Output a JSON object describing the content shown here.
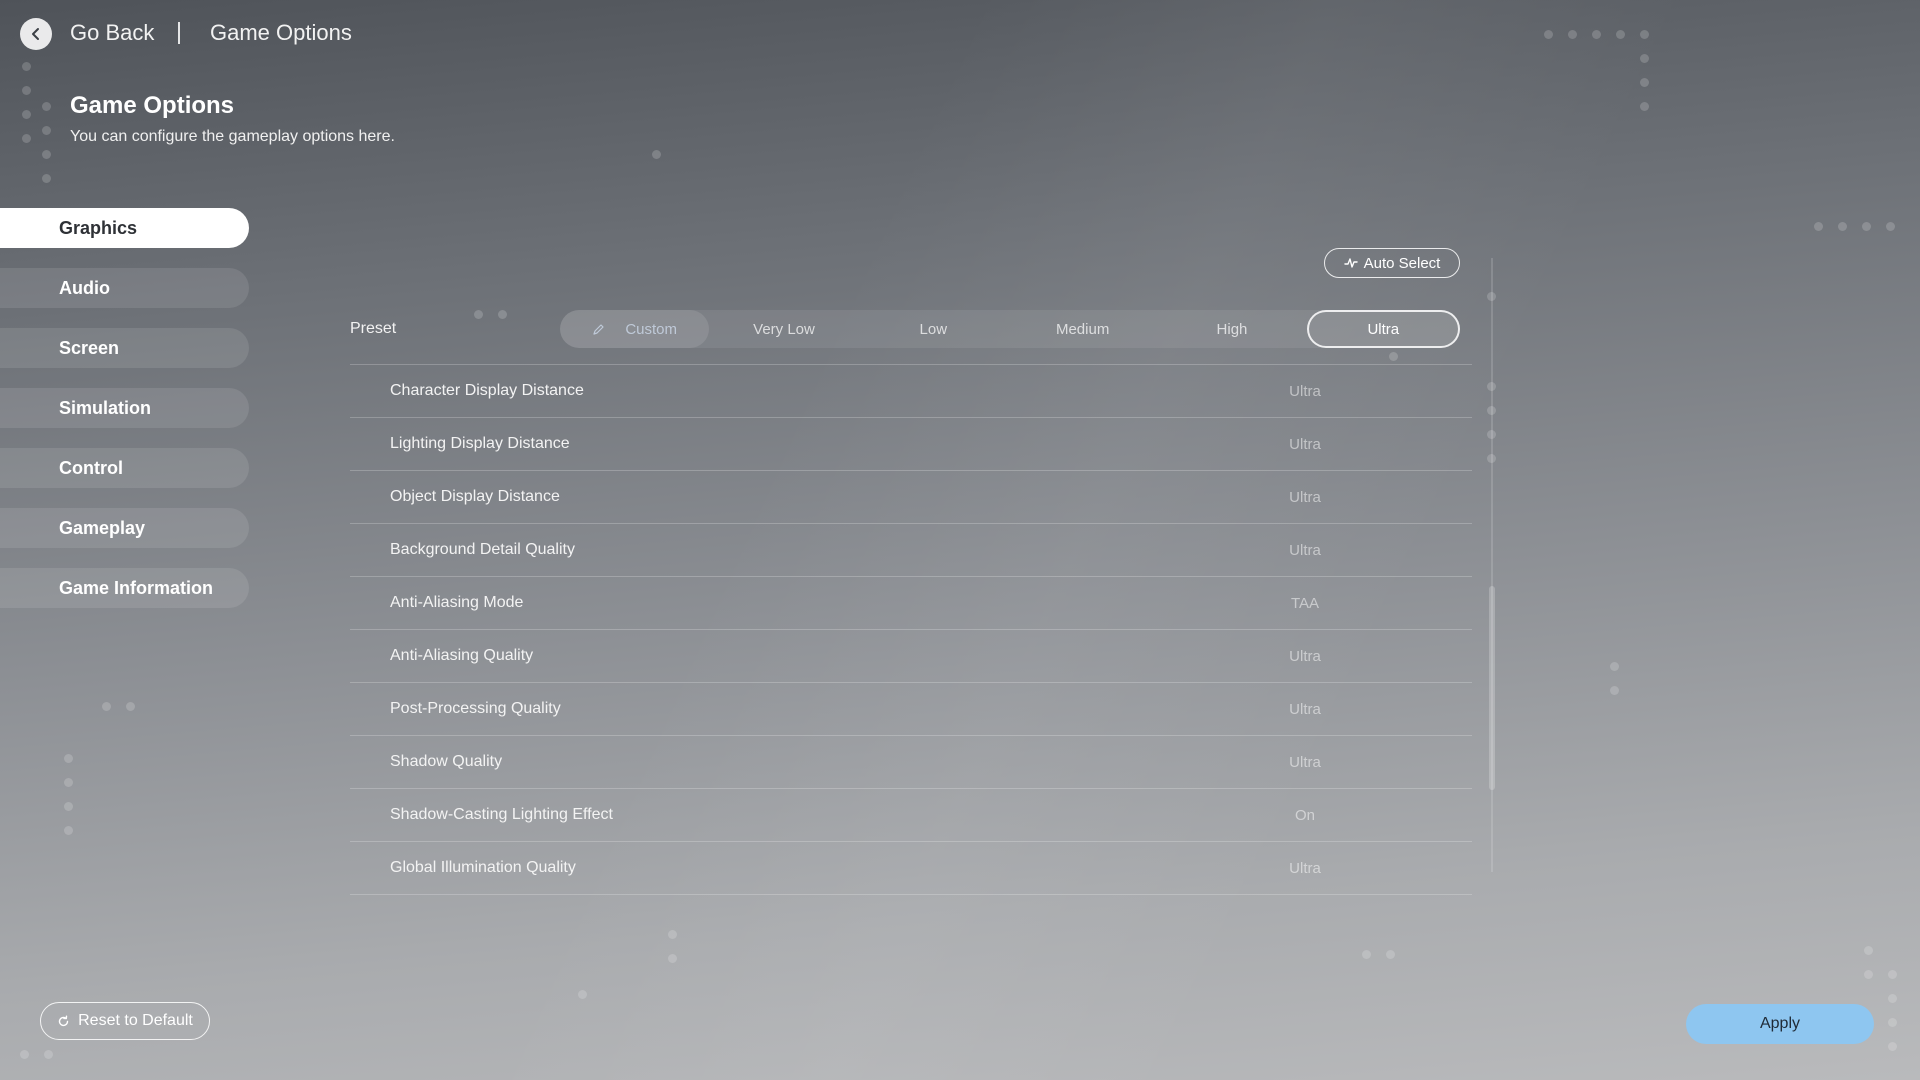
{
  "header": {
    "back_label": "Go Back",
    "breadcrumb": "Game Options"
  },
  "page": {
    "title": "Game Options",
    "subtitle": "You can configure the gameplay options here."
  },
  "sidebar": {
    "items": [
      {
        "label": "Graphics",
        "active": true
      },
      {
        "label": "Audio"
      },
      {
        "label": "Screen"
      },
      {
        "label": "Simulation"
      },
      {
        "label": "Control"
      },
      {
        "label": "Gameplay"
      },
      {
        "label": "Game Information"
      }
    ]
  },
  "auto_select": {
    "label": "Auto Select"
  },
  "preset": {
    "label": "Preset",
    "options": [
      "Custom",
      "Very Low",
      "Low",
      "Medium",
      "High",
      "Ultra"
    ],
    "selected": "Ultra"
  },
  "settings": [
    {
      "label": "Character Display Distance",
      "value": "Ultra"
    },
    {
      "label": "Lighting Display Distance",
      "value": "Ultra"
    },
    {
      "label": "Object Display Distance",
      "value": "Ultra"
    },
    {
      "label": "Background Detail Quality",
      "value": "Ultra"
    },
    {
      "label": "Anti-Aliasing Mode",
      "value": "TAA"
    },
    {
      "label": "Anti-Aliasing Quality",
      "value": "Ultra"
    },
    {
      "label": "Post-Processing Quality",
      "value": "Ultra"
    },
    {
      "label": "Shadow Quality",
      "value": "Ultra"
    },
    {
      "label": "Shadow-Casting Lighting Effect",
      "value": "On"
    },
    {
      "label": "Global Illumination Quality",
      "value": "Ultra"
    }
  ],
  "footer": {
    "reset_label": "Reset to Default",
    "apply_label": "Apply"
  },
  "colors": {
    "apply_button": "#8ec6f0",
    "active_tab": "#ffffff"
  }
}
